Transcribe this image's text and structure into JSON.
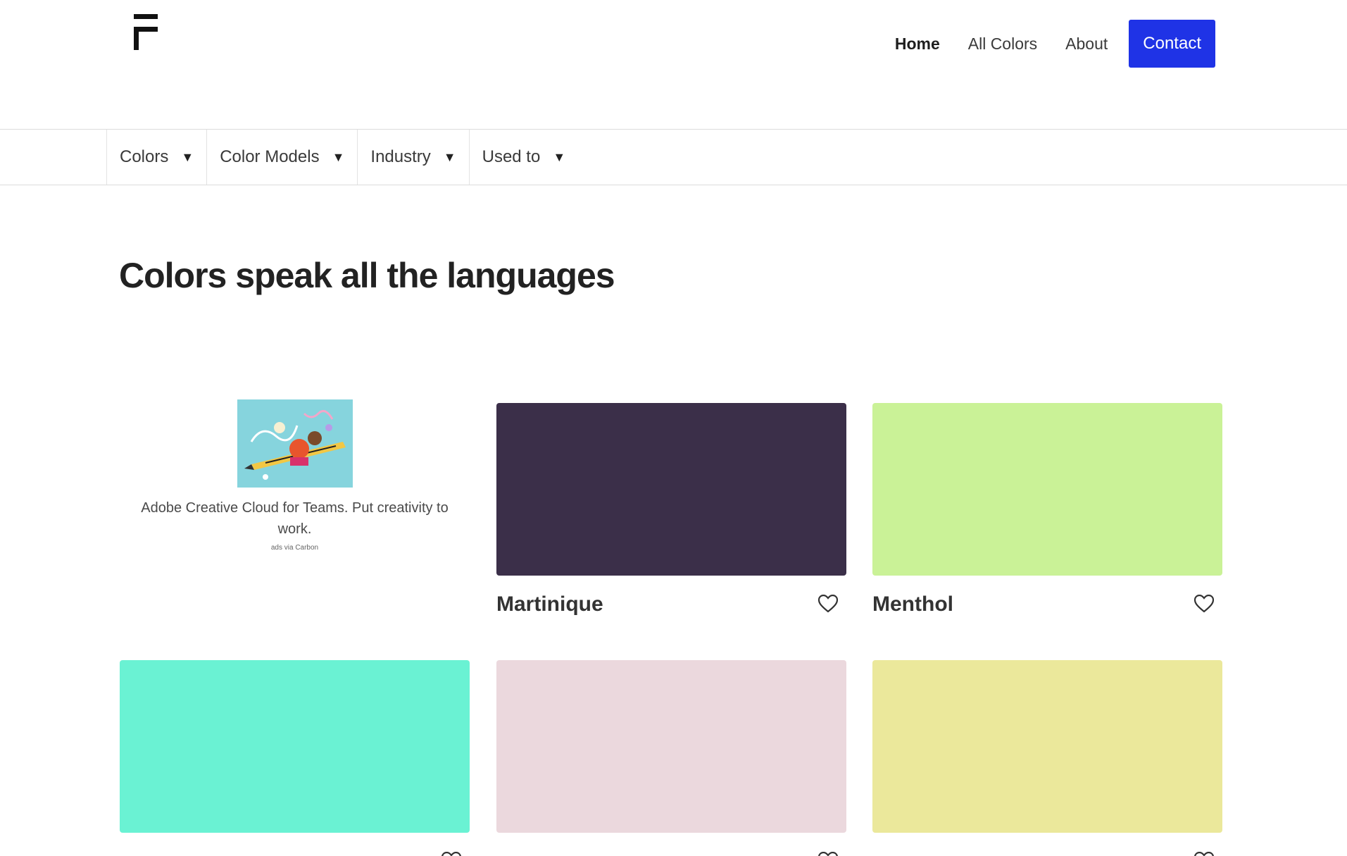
{
  "logo": {
    "icon": "f-logo-icon"
  },
  "nav": {
    "home": "Home",
    "all_colors": "All Colors",
    "about": "About",
    "contact": "Contact",
    "accent": "#1f33e6"
  },
  "filters": [
    {
      "label": "Colors"
    },
    {
      "label": "Color Models"
    },
    {
      "label": "Industry"
    },
    {
      "label": "Used to"
    }
  ],
  "headline": "Colors speak all the languages",
  "ad": {
    "text": "Adobe Creative Cloud for Teams. Put creativity to work.",
    "via": "ads via Carbon"
  },
  "cards": [
    {
      "name": "Martinique",
      "color": "#3b2f49"
    },
    {
      "name": "Menthol",
      "color": "#caf297"
    },
    {
      "name": "",
      "color": "#6af2d3"
    },
    {
      "name": "",
      "color": "#ebd8dd"
    },
    {
      "name": "",
      "color": "#ebe89b"
    }
  ]
}
